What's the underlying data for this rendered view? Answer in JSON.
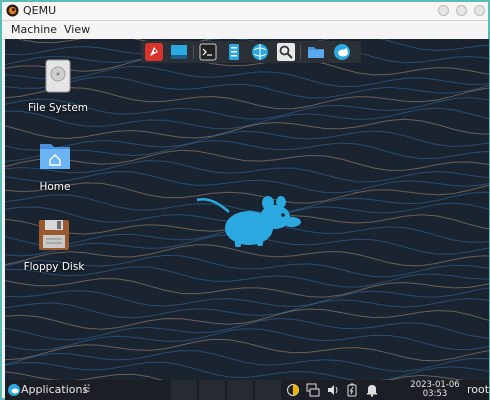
{
  "window": {
    "title": "QEMU"
  },
  "menubar": {
    "items": [
      "Machine",
      "View"
    ]
  },
  "dock": {
    "items": [
      "rocket-icon",
      "window-icon",
      "terminal-icon",
      "file-manager-icon",
      "web-browser-icon",
      "search-icon",
      "folder-icon",
      "xfce-mouse-icon"
    ]
  },
  "desktop": {
    "icons": [
      {
        "label": "File System",
        "icon": "drive-icon"
      },
      {
        "label": "Home",
        "icon": "home-folder-icon"
      },
      {
        "label": "Floppy Disk",
        "icon": "floppy-disk-icon"
      }
    ],
    "colors": {
      "background": "#1a2330",
      "lines_a": "#3a6fa0",
      "lines_b": "#c8a88a",
      "mascot": "#29a9e0"
    }
  },
  "panel": {
    "applications_label": "Applications",
    "clock_date": "2023-01-06",
    "clock_time": "03:53",
    "user": "root"
  }
}
